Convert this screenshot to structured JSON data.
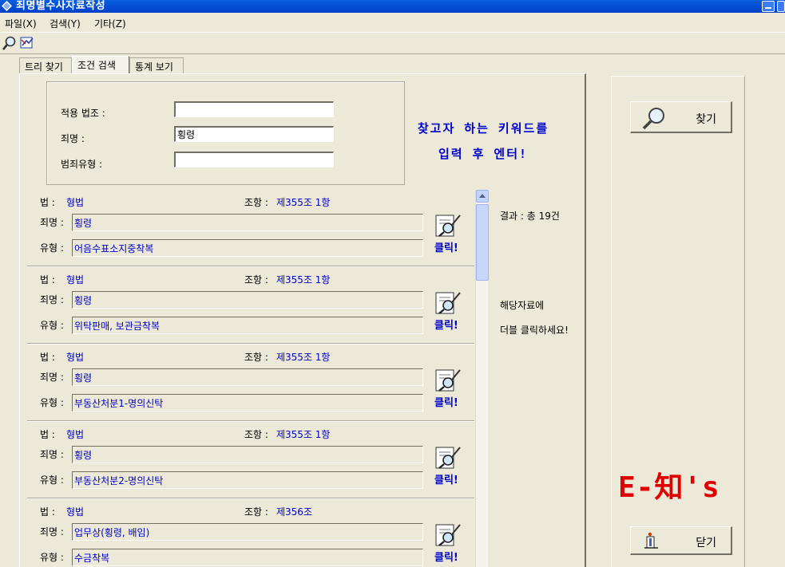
{
  "window": {
    "title": "죄명별수사자료작성"
  },
  "menu": {
    "file": "파일(X)",
    "search": "검색(Y)",
    "etc": "기타(Z)"
  },
  "toolbar": {
    "search_icon": "magnifier-icon",
    "edit_icon": "pen-icon"
  },
  "tabs": [
    "트리 찾기",
    "조건 검색",
    "통계 보기"
  ],
  "condition": {
    "law_label": "적용 법조 :",
    "law_value": "",
    "crime_label": "죄명 :",
    "crime_value": "횡령",
    "type_label": "범죄유형 :",
    "type_value": ""
  },
  "hint": {
    "line1": "찾고자 하는 키워드를",
    "line2": "입력 후 엔터!"
  },
  "labels": {
    "law": "법 :",
    "article": "조항 :",
    "crime": "죄명 :",
    "type": "유형 :",
    "click": "클릭!"
  },
  "records": [
    {
      "law": "형법",
      "article": "제355조 1항",
      "crime": "횡령",
      "type": "어음수표소지중착복"
    },
    {
      "law": "형법",
      "article": "제355조 1항",
      "crime": "횡령",
      "type": "위탁판매, 보관금착복"
    },
    {
      "law": "형법",
      "article": "제355조 1항",
      "crime": "횡령",
      "type": "부동산처분1-명의신탁"
    },
    {
      "law": "형법",
      "article": "제355조 1항",
      "crime": "횡령",
      "type": "부동산처분2-명의신탁"
    },
    {
      "law": "형법",
      "article": "제356조",
      "crime": "업무상(횡령, 배임)",
      "type": "수금착복"
    }
  ],
  "result": {
    "count_text": "결과 : 총 19건",
    "guide_line1": "해당자료에",
    "guide_line2": "더블 클릭하세요!"
  },
  "buttons": {
    "search": "찾기",
    "close": "닫기"
  },
  "brand": "E-知's",
  "colors": {
    "titlebar": "#0a5fe0",
    "value_text": "#0000cc",
    "brand": "#e00000",
    "face": "#ece9d8"
  }
}
